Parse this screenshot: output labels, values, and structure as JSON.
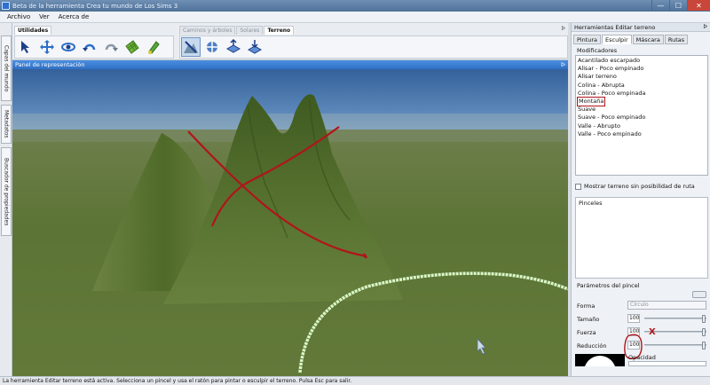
{
  "window": {
    "title": "Beta de la herramienta Crea tu mundo de Los Sims 3",
    "minimize_glyph": "—",
    "maximize_glyph": "☐",
    "close_glyph": "✕"
  },
  "menu": {
    "items": [
      "Archivo",
      "Ver",
      "Acerca de"
    ]
  },
  "sidebar": {
    "tabs": [
      "Capas del mundo",
      "Metadatos",
      "Buscador de propiedades"
    ]
  },
  "toolbar": {
    "left_tab": "Utilidades",
    "right_tabs": [
      "Caminos y árboles",
      "Solares",
      "Terreno"
    ],
    "active_right_tab": "Terreno",
    "pin_glyph": "ᐅ"
  },
  "viewport": {
    "panel_title": "Panel de representación",
    "pin_glyph": "ᐅ"
  },
  "right_panel": {
    "title": "Herramientas Editar terreno",
    "pin_glyph": "ᐅ",
    "tabs": [
      "Pintura",
      "Esculpir",
      "Máscara",
      "Rutas"
    ],
    "active_tab": "Esculpir",
    "modifiers_label": "Modificadores",
    "modifiers": [
      "Acantilado escarpado",
      "Alisar - Poco empinado",
      "Alisar terreno",
      "Colina - Abrupta",
      "Colina - Poco empinada",
      "Montaña",
      "Suave",
      "Suave - Poco empinado",
      "Valle - Abrupto",
      "Valle - Poco empinado"
    ],
    "checkbox_label": "Mostrar terreno sin posibilidad de ruta",
    "brushes_label": "Pinceles",
    "brush_params_label": "Parámetros del pincel",
    "params": {
      "forma_label": "Forma",
      "forma_value": "Círculo",
      "tamano_label": "Tamaño",
      "tamano_value": "100",
      "fuerza_label": "Fuerza",
      "fuerza_value": "100",
      "reduccion_label": "Reducción",
      "reduccion_value": "100",
      "opacidad_label": "Opacidad"
    },
    "annotation_x": "X"
  },
  "status": {
    "text": "La herramienta Editar terreno está activa. Selecciona un pincel y usa el ratón para pintar o esculpir el terreno. Pulsa Esc para salir."
  },
  "colors": {
    "annotation_red": "#b0151b",
    "terrain_green": "#5f7a36",
    "sky_blue": "#3f6ea5",
    "brush_ring": "#d9f7c8"
  }
}
